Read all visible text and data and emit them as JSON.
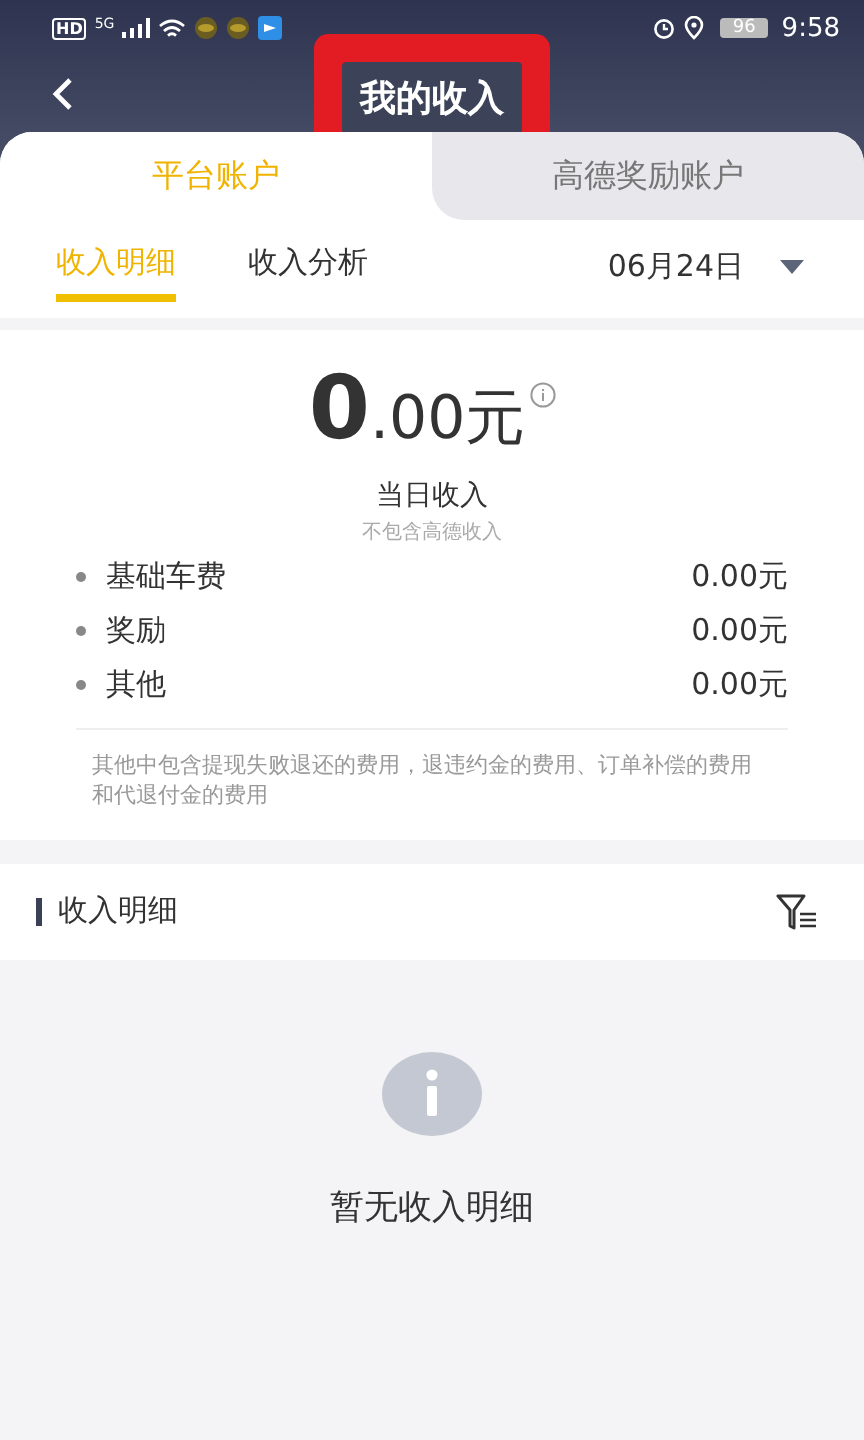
{
  "status_bar": {
    "hd": "HD",
    "network": "5G",
    "battery": "96",
    "time": "9:58"
  },
  "header": {
    "title": "我的收入",
    "highlighted": true
  },
  "account_tabs": [
    {
      "label": "平台账户",
      "selected": true
    },
    {
      "label": "高德奖励账户",
      "selected": false
    }
  ],
  "sub_tabs": [
    {
      "label": "收入明细",
      "selected": true
    },
    {
      "label": "收入分析",
      "selected": false
    }
  ],
  "date": "06月24日",
  "summary": {
    "amount_integer": "0",
    "amount_decimal": ".00元",
    "label": "当日收入",
    "sublabel": "不包含高德收入",
    "items": [
      {
        "name": "基础车费",
        "value": "0.00元"
      },
      {
        "name": "奖励",
        "value": "0.00元"
      },
      {
        "name": "其他",
        "value": "0.00元"
      }
    ],
    "note": "其他中包含提现失败退还的费用，退违约金的费用、订单补偿的费用和代退付金的费用"
  },
  "details": {
    "title": "收入明细",
    "empty_text": "暂无收入明细"
  }
}
